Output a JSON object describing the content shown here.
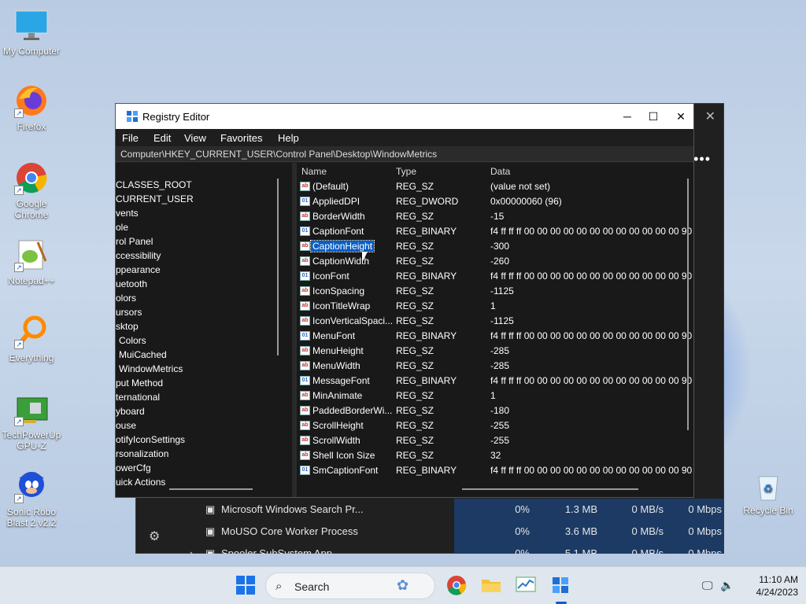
{
  "desktop": {
    "icons": [
      {
        "label": "My Computer",
        "icon": "monitor-icon"
      },
      {
        "label": "Firefox",
        "icon": "firefox-icon"
      },
      {
        "label": "Google Chrome",
        "icon": "chrome-icon"
      },
      {
        "label": "Notepad++",
        "icon": "notepad-plus-icon"
      },
      {
        "label": "Everything",
        "icon": "magnifier-icon"
      },
      {
        "label": "TechPowerUp GPU-Z",
        "icon": "gpu-card-icon"
      },
      {
        "label": "Sonic Robo Blast 2 v2.2",
        "icon": "sonic-icon"
      }
    ],
    "recycle_bin": "Recycle Bin"
  },
  "taskmgr": {
    "rows": [
      {
        "name": "Microsoft Windows Search Pr...",
        "cpu": "0%",
        "mem": "1.3 MB",
        "disk": "0 MB/s",
        "net": "0 Mbps"
      },
      {
        "name": "MoUSO Core Worker Process",
        "cpu": "0%",
        "mem": "3.6 MB",
        "disk": "0 MB/s",
        "net": "0 Mbps"
      },
      {
        "name": "Spooler SubSystem App",
        "cpu": "0%",
        "mem": "5.1 MB",
        "disk": "0 MB/s",
        "net": "0 Mbps"
      }
    ]
  },
  "regedit": {
    "title": "Registry Editor",
    "menu": [
      "File",
      "Edit",
      "View",
      "Favorites",
      "Help"
    ],
    "address": "Computer\\HKEY_CURRENT_USER\\Control Panel\\Desktop\\WindowMetrics",
    "tree": [
      "CLASSES_ROOT",
      "CURRENT_USER",
      "vents",
      "ole",
      "rol Panel",
      "ccessibility",
      "ppearance",
      "uetooth",
      "olors",
      "ursors",
      "sktop",
      "Colors",
      "MuiCached",
      "WindowMetrics",
      "put Method",
      "ternational",
      "yboard",
      "ouse",
      "otifyIconSettings",
      "rsonalization",
      "owerCfg",
      "uick Actions"
    ],
    "columns": {
      "name": "Name",
      "type": "Type",
      "data": "Data"
    },
    "values": [
      {
        "name": "(Default)",
        "type": "REG_SZ",
        "data": "(value not set)",
        "kind": "sz"
      },
      {
        "name": "AppliedDPI",
        "type": "REG_DWORD",
        "data": "0x00000060 (96)",
        "kind": "bin"
      },
      {
        "name": "BorderWidth",
        "type": "REG_SZ",
        "data": "-15",
        "kind": "sz"
      },
      {
        "name": "CaptionFont",
        "type": "REG_BINARY",
        "data": "f4 ff ff ff 00 00 00 00 00 00 00 00 00 00 00 00 90",
        "kind": "bin"
      },
      {
        "name": "CaptionHeight",
        "type": "REG_SZ",
        "data": "-300",
        "kind": "sz"
      },
      {
        "name": "CaptionWidth",
        "type": "REG_SZ",
        "data": "-260",
        "kind": "sz"
      },
      {
        "name": "IconFont",
        "type": "REG_BINARY",
        "data": "f4 ff ff ff 00 00 00 00 00 00 00 00 00 00 00 00 90",
        "kind": "bin"
      },
      {
        "name": "IconSpacing",
        "type": "REG_SZ",
        "data": "-1125",
        "kind": "sz"
      },
      {
        "name": "IconTitleWrap",
        "type": "REG_SZ",
        "data": "1",
        "kind": "sz"
      },
      {
        "name": "IconVerticalSpaci...",
        "type": "REG_SZ",
        "data": "-1125",
        "kind": "sz"
      },
      {
        "name": "MenuFont",
        "type": "REG_BINARY",
        "data": "f4 ff ff ff 00 00 00 00 00 00 00 00 00 00 00 00 90",
        "kind": "bin"
      },
      {
        "name": "MenuHeight",
        "type": "REG_SZ",
        "data": "-285",
        "kind": "sz"
      },
      {
        "name": "MenuWidth",
        "type": "REG_SZ",
        "data": "-285",
        "kind": "sz"
      },
      {
        "name": "MessageFont",
        "type": "REG_BINARY",
        "data": "f4 ff ff ff 00 00 00 00 00 00 00 00 00 00 00 00 90",
        "kind": "bin"
      },
      {
        "name": "MinAnimate",
        "type": "REG_SZ",
        "data": "1",
        "kind": "sz"
      },
      {
        "name": "PaddedBorderWi...",
        "type": "REG_SZ",
        "data": "-180",
        "kind": "sz"
      },
      {
        "name": "ScrollHeight",
        "type": "REG_SZ",
        "data": "-255",
        "kind": "sz"
      },
      {
        "name": "ScrollWidth",
        "type": "REG_SZ",
        "data": "-255",
        "kind": "sz"
      },
      {
        "name": "Shell Icon Size",
        "type": "REG_SZ",
        "data": "32",
        "kind": "sz"
      },
      {
        "name": "SmCaptionFont",
        "type": "REG_BINARY",
        "data": "f4 ff ff ff 00 00 00 00 00 00 00 00 00 00 00 00 90",
        "kind": "bin"
      }
    ],
    "selected_index": 4
  },
  "taskbar": {
    "search_label": "Search",
    "time": "11:10 AM",
    "date": "4/24/2023"
  }
}
